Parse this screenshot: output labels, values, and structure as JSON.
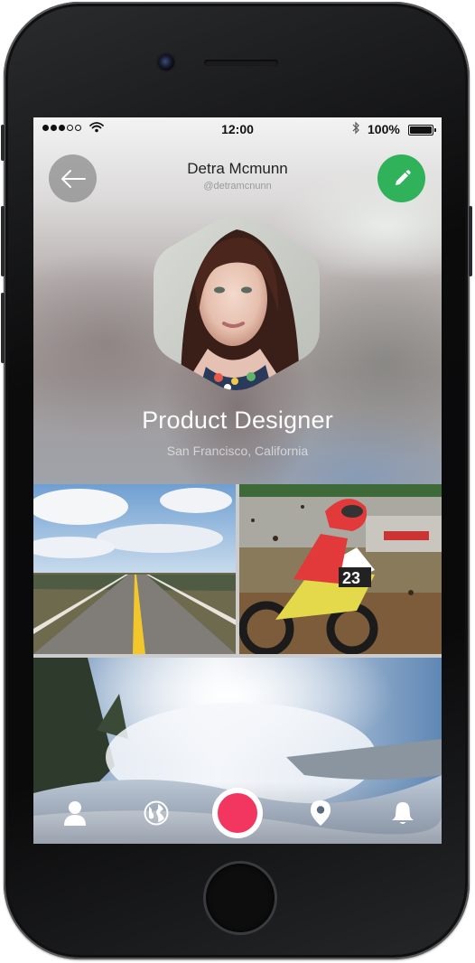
{
  "status_bar": {
    "time": "12:00",
    "battery": "100%",
    "signal_bars_filled": 3,
    "signal_bars_total": 5
  },
  "profile": {
    "name": "Detra Mcmunn",
    "handle": "@detramcnunn",
    "job_title": "Product Designer",
    "location": "San Francisco, California"
  },
  "photos": [
    {
      "name": "road-photo"
    },
    {
      "name": "motocross-photo"
    },
    {
      "name": "snow-spray-photo"
    }
  ],
  "tab_bar": {
    "items": [
      "profile-icon",
      "globe-icon",
      "record-button",
      "map-pin-icon",
      "bell-icon"
    ]
  },
  "colors": {
    "accent_green": "#2fb25a",
    "record_red": "#f23660",
    "back_button": "#8c8c8c"
  }
}
